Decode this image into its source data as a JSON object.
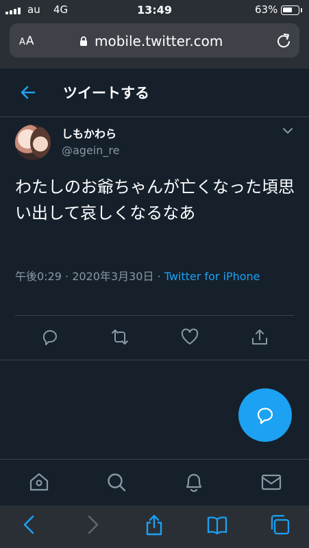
{
  "status_bar": {
    "carrier": "au",
    "network": "4G",
    "time": "13:49",
    "battery_percent": "63%",
    "battery_level": 0.63
  },
  "browser": {
    "text_size_label_small": "A",
    "text_size_label_large": "A",
    "url": "mobile.twitter.com",
    "icons": [
      "lock-icon",
      "reload-icon"
    ]
  },
  "header": {
    "title": "ツイートする",
    "back_icon": "arrow-left-icon"
  },
  "tweet": {
    "display_name": "しもかわら",
    "handle": "@agein_re",
    "text": "わたしのお爺ちゃんが亡くなった頃思い出して哀しくなるなあ",
    "timestamp": "午後0:29 · 2020年3月30日 · ",
    "source": "Twitter for iPhone",
    "actions": [
      "reply-icon",
      "retweet-icon",
      "like-icon",
      "share-icon"
    ]
  },
  "fab": {
    "icon": "compose-message-icon"
  },
  "bottom_nav": {
    "items": [
      "home-icon",
      "search-icon",
      "notifications-icon",
      "messages-icon"
    ]
  },
  "safari_toolbar": {
    "items": [
      "back-icon",
      "forward-icon",
      "share-icon",
      "bookmarks-icon",
      "tabs-icon"
    ]
  },
  "colors": {
    "background": "#15202b",
    "accent": "#1da1f2",
    "secondary_text": "#8899a6",
    "divider": "#38444d",
    "browser_chrome": "#2a2f35"
  }
}
